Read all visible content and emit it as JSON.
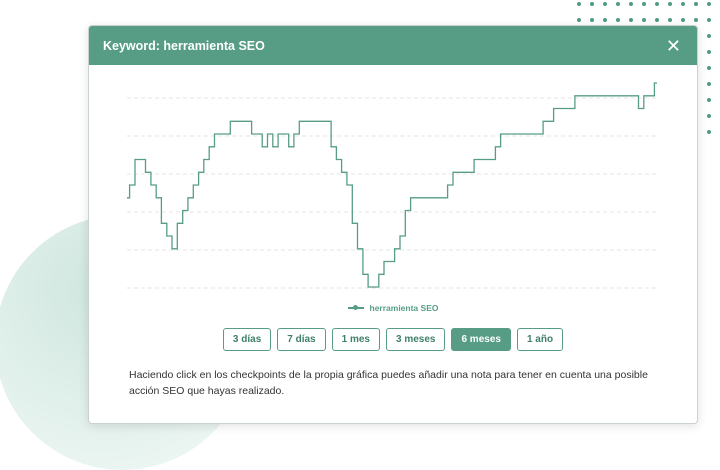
{
  "modal": {
    "title": "Keyword: herramienta SEO",
    "close_icon": "close-icon"
  },
  "chart_data": {
    "type": "line",
    "series": [
      {
        "name": "herramienta SEO",
        "color": "#579d85",
        "values": [
          10,
          9,
          7,
          7,
          8,
          9,
          10,
          12,
          13,
          14,
          12,
          11,
          10,
          9,
          8,
          7,
          6,
          5,
          5,
          5,
          4,
          4,
          4,
          4,
          5,
          5,
          6,
          5,
          6,
          5,
          5,
          6,
          5,
          4,
          4,
          4,
          4,
          4,
          4,
          6,
          7,
          8,
          9,
          12,
          14,
          16,
          17,
          17,
          16,
          15,
          15,
          14,
          13,
          11,
          10,
          10,
          10,
          10,
          10,
          10,
          10,
          9,
          8,
          8,
          8,
          8,
          7,
          7,
          7,
          7,
          6,
          5,
          5,
          5,
          5,
          5,
          5,
          5,
          5,
          4,
          4,
          3,
          3,
          3,
          3,
          2,
          2,
          2,
          2,
          2,
          2,
          2,
          2,
          2,
          2,
          2,
          2,
          3,
          2,
          2,
          1
        ]
      }
    ],
    "y_inverted": true,
    "grid": true,
    "legend": "bottom"
  },
  "legend": {
    "label": "herramienta SEO"
  },
  "range_buttons": [
    {
      "label": "3 días",
      "active": false
    },
    {
      "label": "7 días",
      "active": false
    },
    {
      "label": "1 mes",
      "active": false
    },
    {
      "label": "3 meses",
      "active": false
    },
    {
      "label": "6 meses",
      "active": true
    },
    {
      "label": "1 año",
      "active": false
    }
  ],
  "help_text": "Haciendo click en los checkpoints de la propia gráfica puedes añadir una nota para tener en cuenta una posible acción SEO que hayas realizado."
}
